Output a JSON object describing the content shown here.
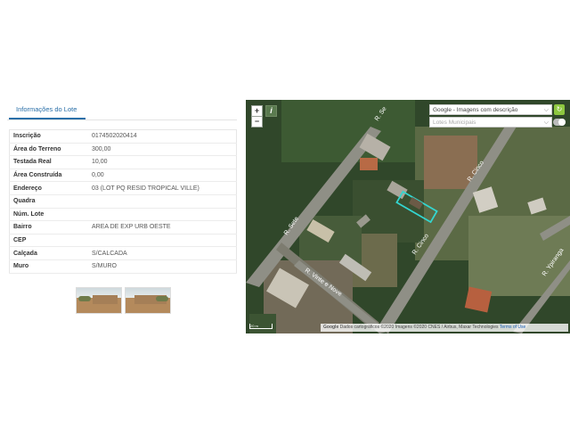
{
  "tabs": [
    {
      "label": "Informações do Lote"
    }
  ],
  "lot_info": [
    {
      "label": "Inscrição",
      "value": "0174502020414"
    },
    {
      "label": "Área do Terreno",
      "value": "300,00"
    },
    {
      "label": "Testada Real",
      "value": "10,00"
    },
    {
      "label": "Área Construída",
      "value": "0,00"
    },
    {
      "label": "Endereço",
      "value": "03 (LOT PQ RESID TROPICAL VILLE)"
    },
    {
      "label": "Quadra",
      "value": ""
    },
    {
      "label": "Núm. Lote",
      "value": ""
    },
    {
      "label": "Bairro",
      "value": "AREA DE EXP URB OESTE"
    },
    {
      "label": "CEP",
      "value": ""
    },
    {
      "label": "Calçada",
      "value": "S/CALCADA"
    },
    {
      "label": "Muro",
      "value": "S/MURO"
    }
  ],
  "photos": [
    {
      "name": "lot-photo-1"
    },
    {
      "name": "lot-photo-2"
    }
  ],
  "map": {
    "zoom_in": "+",
    "zoom_out": "−",
    "info": "i",
    "basemap_select": "Google - Imagens com descrição",
    "overlay_select": "Lotes Municipais",
    "refresh": "↻",
    "street_labels": {
      "sete": "R. Sete",
      "cinco": "R. Cinco",
      "vinte_e_nove": "R. Vinte e Nove",
      "cinco_lower": "R. Cinco",
      "ipiranga": "R. Ypiranga",
      "top": "R. Se"
    },
    "google": "Google",
    "attribution": "Dados cartográficos ©2020 Imagens ©2020 CNES / Airbus, Maxar Technologies",
    "terms": "Terms of Use",
    "scale": "20 m"
  }
}
